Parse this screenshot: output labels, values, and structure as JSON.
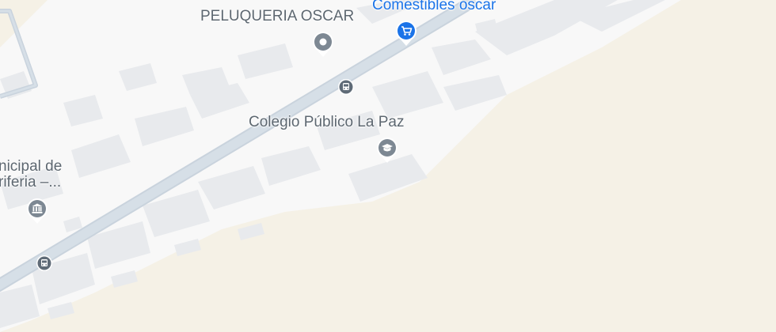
{
  "colors": {
    "land": "#f5f1e6",
    "urban": "#f8f8f8",
    "building": "#e8eaed",
    "road": "#d6dfe7",
    "road_outline": "#c9d3dd",
    "poi_gray": "#7d8893",
    "poi_blue": "#1a73e8",
    "label_gray": "#5d6770",
    "label_blue": "#1a73e8"
  },
  "pois": {
    "peluqueria": {
      "name": "PELUQUERIA OSCAR",
      "icon": "place-dot-icon"
    },
    "comestibles": {
      "name": "Comestibles oscar",
      "icon": "shopping-cart-icon"
    },
    "colegio": {
      "name": "Colegio Público La Paz",
      "icon": "school-icon"
    },
    "municipal": {
      "line1": "nicipal de",
      "line2": "riferia –...",
      "icon": "museum-icon"
    }
  },
  "transit": {
    "stop1": {
      "icon": "bus-stop-icon"
    },
    "stop2": {
      "icon": "bus-stop-icon"
    }
  }
}
